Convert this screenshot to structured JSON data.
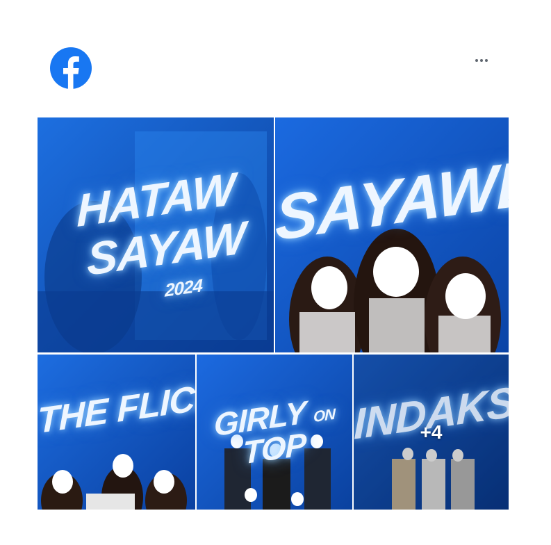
{
  "header": {
    "logo_icon": "facebook-logo-icon",
    "more_icon": "more-horizontal-icon",
    "brand_color": "#1877F2"
  },
  "gallery": {
    "tiles": [
      {
        "title_line1": "HATAW",
        "title_line2": "SAYAW",
        "year": "2024"
      },
      {
        "title": "SAYAWE"
      },
      {
        "title": "THE FLICKER"
      },
      {
        "title_line1": "GIRLY",
        "title_on": "ON",
        "title_line2": "TOP"
      },
      {
        "title": "INDAKS",
        "more_count": "+4"
      }
    ]
  },
  "colors": {
    "tile_blue": "#0b4fb8",
    "tile_blue_dark": "#083a8c",
    "glow": "#bfe3ff"
  }
}
